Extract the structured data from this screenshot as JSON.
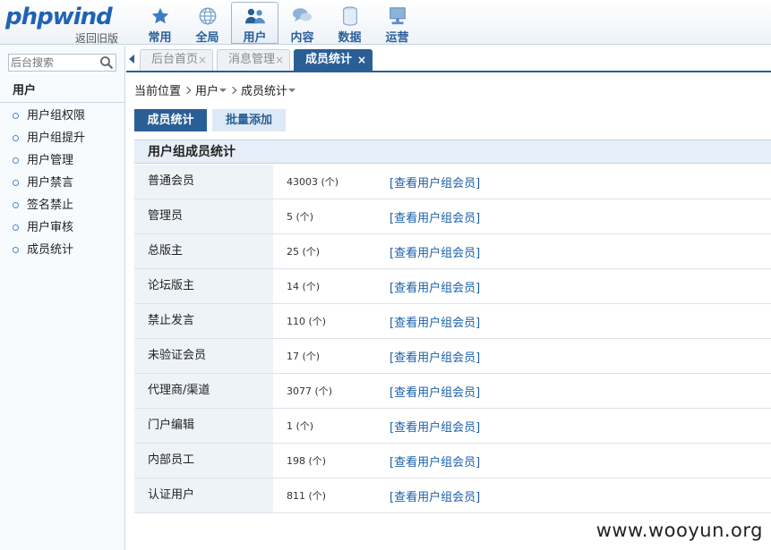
{
  "app": {
    "logo_text": "phpwind",
    "back_label": "返回旧版"
  },
  "nav": [
    {
      "label": "常用",
      "icon": "star-icon"
    },
    {
      "label": "全局",
      "icon": "globe-icon"
    },
    {
      "label": "用户",
      "icon": "users-icon",
      "active": true
    },
    {
      "label": "内容",
      "icon": "chat-icon"
    },
    {
      "label": "数据",
      "icon": "database-icon"
    },
    {
      "label": "运营",
      "icon": "monitor-icon"
    }
  ],
  "sidebar": {
    "search_placeholder": "后台搜索",
    "title": "用户",
    "items": [
      {
        "label": "用户组权限"
      },
      {
        "label": "用户组提升"
      },
      {
        "label": "用户管理"
      },
      {
        "label": "用户禁言"
      },
      {
        "label": "签名禁止"
      },
      {
        "label": "用户审核"
      },
      {
        "label": "成员统计"
      }
    ]
  },
  "tabs": [
    {
      "label": "后台首页",
      "close": "×"
    },
    {
      "label": "消息管理",
      "close": "×"
    },
    {
      "label": "成员统计",
      "close": "×",
      "active": true
    }
  ],
  "breadcrumb": {
    "root": "当前位置",
    "level1": "用户",
    "level2": "成员统计"
  },
  "buttons": {
    "stats": "成员统计",
    "batch_add": "批量添加"
  },
  "panel": {
    "title": "用户组成员统计",
    "link_label": "[查看用户组会员]",
    "rows": [
      {
        "group": "普通会员",
        "count": "43003 (个)"
      },
      {
        "group": "管理员",
        "count": "5 (个)"
      },
      {
        "group": "总版主",
        "count": "25 (个)"
      },
      {
        "group": "论坛版主",
        "count": "14 (个)"
      },
      {
        "group": "禁止发言",
        "count": "110 (个)"
      },
      {
        "group": "未验证会员",
        "count": "17 (个)"
      },
      {
        "group": "代理商/渠道",
        "count": "3077 (个)"
      },
      {
        "group": "门户编辑",
        "count": "1 (个)"
      },
      {
        "group": "内部员工",
        "count": "198 (个)"
      },
      {
        "group": "认证用户",
        "count": "811 (个)"
      }
    ]
  },
  "watermark": "www.wooyun.org",
  "colors": {
    "accent": "#2a5f96",
    "link": "#1a5fa8",
    "header_bg": "#eef3f8",
    "sidebar_bg": "#f7fbfe"
  }
}
